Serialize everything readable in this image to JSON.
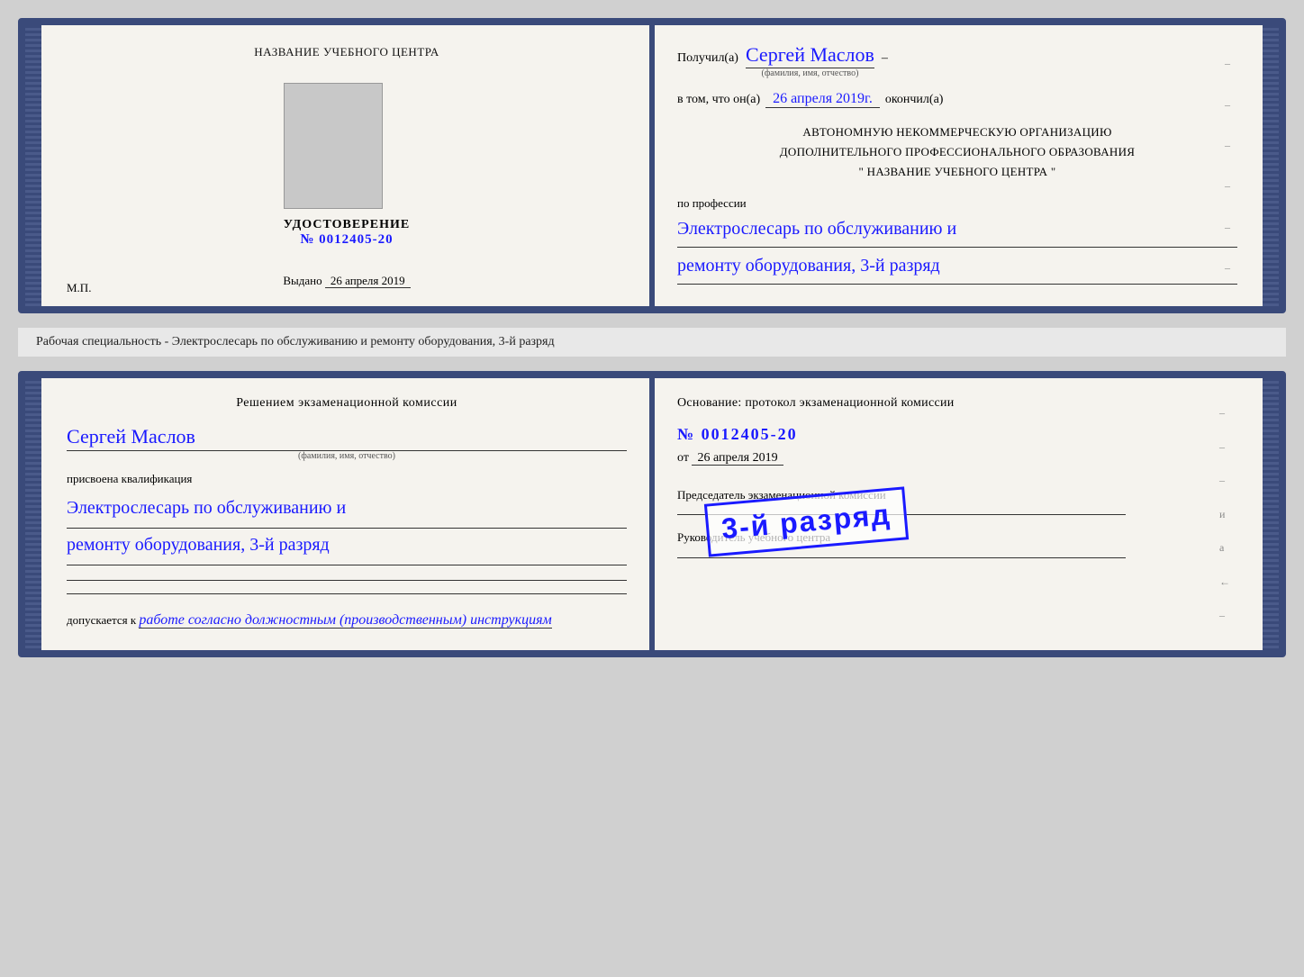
{
  "top_doc": {
    "left": {
      "org_name": "НАЗВАНИЕ УЧЕБНОГО ЦЕНТРА",
      "udostoverenie": "УДОСТОВЕРЕНИЕ",
      "number": "№ 0012405-20",
      "vydano": "Выдано",
      "vydano_date": "26 апреля 2019",
      "mp": "М.П."
    },
    "right": {
      "poluchil": "Получил(а)",
      "fio": "Сергей Маслов",
      "fio_subtitle": "(фамилия, имя, отчество)",
      "vtom": "в том, что он(а)",
      "date": "26 апреля 2019г.",
      "okonchil": "окончил(а)",
      "org_line1": "АВТОНОМНУЮ НЕКОММЕРЧЕСКУЮ ОРГАНИЗАЦИЮ",
      "org_line2": "ДОПОЛНИТЕЛЬНОГО ПРОФЕССИОНАЛЬНОГО ОБРАЗОВАНИЯ",
      "org_line3": "\"   НАЗВАНИЕ УЧЕБНОГО ЦЕНТРА    \"",
      "po_professii": "по профессии",
      "profession_line1": "Электрослесарь по обслуживанию и",
      "profession_line2": "ремонту оборудования, 3-й разряд"
    }
  },
  "label": {
    "text": "Рабочая специальность - Электрослесарь по обслуживанию и ремонту оборудования, 3-й разряд"
  },
  "bottom_doc": {
    "left": {
      "resheniem": "Решением экзаменационной комиссии",
      "fio": "Сергей Маслов",
      "fio_subtitle": "(фамилия, имя, отчество)",
      "prisvoena": "присвоена квалификация",
      "qualification_line1": "Электрослесарь по обслуживанию и",
      "qualification_line2": "ремонту оборудования, 3-й разряд",
      "dopuskaetsya": "допускается к",
      "dopusk_text": "работе согласно должностным (производственным) инструкциям"
    },
    "right": {
      "osnovanie": "Основание: протокол экзаменационной комиссии",
      "number": "№  0012405-20",
      "ot": "от",
      "ot_date": "26 апреля 2019",
      "predsedatel": "Председатель экзаменационной комиссии",
      "rukovoditel": "Руководитель учебного центра"
    },
    "stamp": {
      "text": "3-й разряд"
    }
  }
}
